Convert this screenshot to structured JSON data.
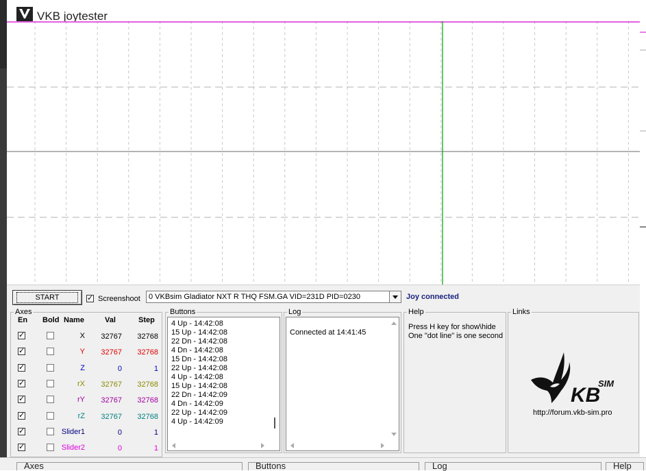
{
  "window": {
    "title": "VKB joytester"
  },
  "colors": {
    "x_line": "#d000d0",
    "y_line": "#00a000",
    "axis_default": "#000000"
  },
  "toolbar": {
    "start_label": "START",
    "screenshoot_label": "Screenshoot",
    "screenshoot_checked": true,
    "device_selected": "0  VKBsim Gladiator NXT R THQ FSM.GA  VID=231D PID=0230",
    "status": "Joy connected"
  },
  "axes": {
    "title": "Axes",
    "headers": {
      "en": "En",
      "bold": "Bold",
      "name": "Name",
      "val": "Val",
      "step": "Step"
    },
    "rows": [
      {
        "name": "X",
        "val": "32767",
        "step": "32768",
        "color": "#000000",
        "en": true,
        "bold": false
      },
      {
        "name": "Y",
        "val": "32767",
        "step": "32768",
        "color": "#e00000",
        "en": true,
        "bold": false
      },
      {
        "name": "Z",
        "val": "0",
        "step": "1",
        "color": "#0000c0",
        "en": true,
        "bold": false
      },
      {
        "name": "rX",
        "val": "32767",
        "step": "32768",
        "color": "#8a8a00",
        "en": true,
        "bold": false
      },
      {
        "name": "rY",
        "val": "32767",
        "step": "32768",
        "color": "#a000a0",
        "en": true,
        "bold": false
      },
      {
        "name": "rZ",
        "val": "32767",
        "step": "32768",
        "color": "#008080",
        "en": true,
        "bold": false
      },
      {
        "name": "Slider1",
        "val": "0",
        "step": "1",
        "color": "#000080",
        "en": true,
        "bold": false
      },
      {
        "name": "Slider2",
        "val": "0",
        "step": "1",
        "color": "#e000e0",
        "en": true,
        "bold": false
      }
    ]
  },
  "buttons": {
    "title": "Buttons",
    "items": [
      "4 Up - 14:42:08",
      "15 Up - 14:42:08",
      "22 Dn - 14:42:08",
      "4 Dn - 14:42:08",
      "15 Dn - 14:42:08",
      "22 Up - 14:42:08",
      "4 Up - 14:42:08",
      "15 Up - 14:42:08",
      "22 Dn - 14:42:09",
      "4 Dn - 14:42:09",
      "22 Up - 14:42:09",
      "4 Up - 14:42:09"
    ]
  },
  "log": {
    "title": "Log",
    "entries": [
      "Connected at 14:41:45"
    ]
  },
  "help": {
    "title": "Help",
    "lines": [
      "Press H key for show\\hide",
      "One \"dot line\" is one second"
    ]
  },
  "links": {
    "title": "Links",
    "url": "http://forum.vkb-sim.pro",
    "logo_text": "KB",
    "logo_sup": "SIM"
  },
  "bottom_tabs": [
    "Axes",
    "Buttons",
    "Log",
    "Help"
  ]
}
